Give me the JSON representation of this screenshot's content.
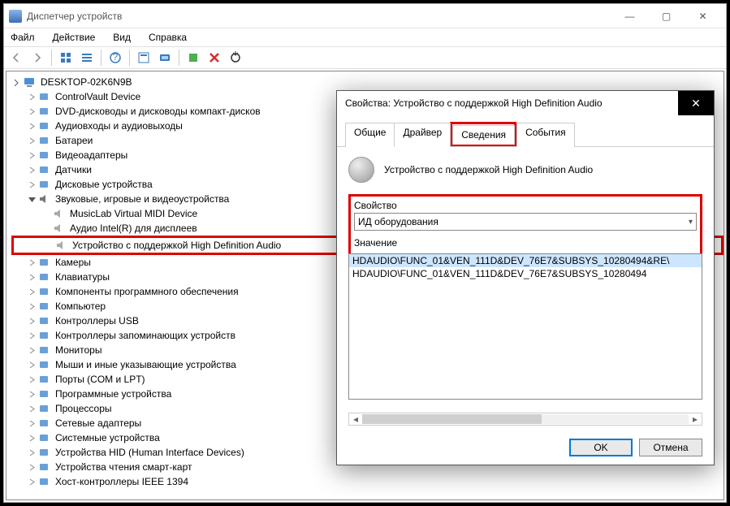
{
  "window": {
    "title": "Диспетчер устройств"
  },
  "menu": {
    "file": "Файл",
    "action": "Действие",
    "view": "Вид",
    "help": "Справка"
  },
  "tree": {
    "root": "DESKTOP-02K6N9B",
    "items": [
      "ControlVault Device",
      "DVD-дисководы и дисководы компакт-дисков",
      "Аудиовходы и аудиовыходы",
      "Батареи",
      "Видеоадаптеры",
      "Датчики",
      "Дисковые устройства"
    ],
    "sound_group": "Звуковые, игровые и видеоустройства",
    "sound_children": [
      "MusicLab Virtual MIDI Device",
      "Аудио Intel(R) для дисплеев",
      "Устройство с поддержкой High Definition Audio"
    ],
    "items2": [
      "Камеры",
      "Клавиатуры",
      "Компоненты программного обеспечения",
      "Компьютер",
      "Контроллеры USB",
      "Контроллеры запоминающих устройств",
      "Мониторы",
      "Мыши и иные указывающие устройства",
      "Порты (COM и LPT)",
      "Программные устройства",
      "Процессоры",
      "Сетевые адаптеры",
      "Системные устройства",
      "Устройства HID (Human Interface Devices)",
      "Устройства чтения смарт-карт",
      "Хост-контроллеры IEEE 1394"
    ]
  },
  "dialog": {
    "title": "Свойства: Устройство с поддержкой High Definition Audio",
    "tabs": {
      "general": "Общие",
      "driver": "Драйвер",
      "details": "Сведения",
      "events": "События"
    },
    "device_name": "Устройство с поддержкой High Definition Audio",
    "property_label": "Свойство",
    "property_value": "ИД оборудования",
    "value_label": "Значение",
    "values": [
      "HDAUDIO\\FUNC_01&VEN_111D&DEV_76E7&SUBSYS_10280494&RE\\",
      "HDAUDIO\\FUNC_01&VEN_111D&DEV_76E7&SUBSYS_10280494"
    ],
    "ok": "OK",
    "cancel": "Отмена"
  }
}
